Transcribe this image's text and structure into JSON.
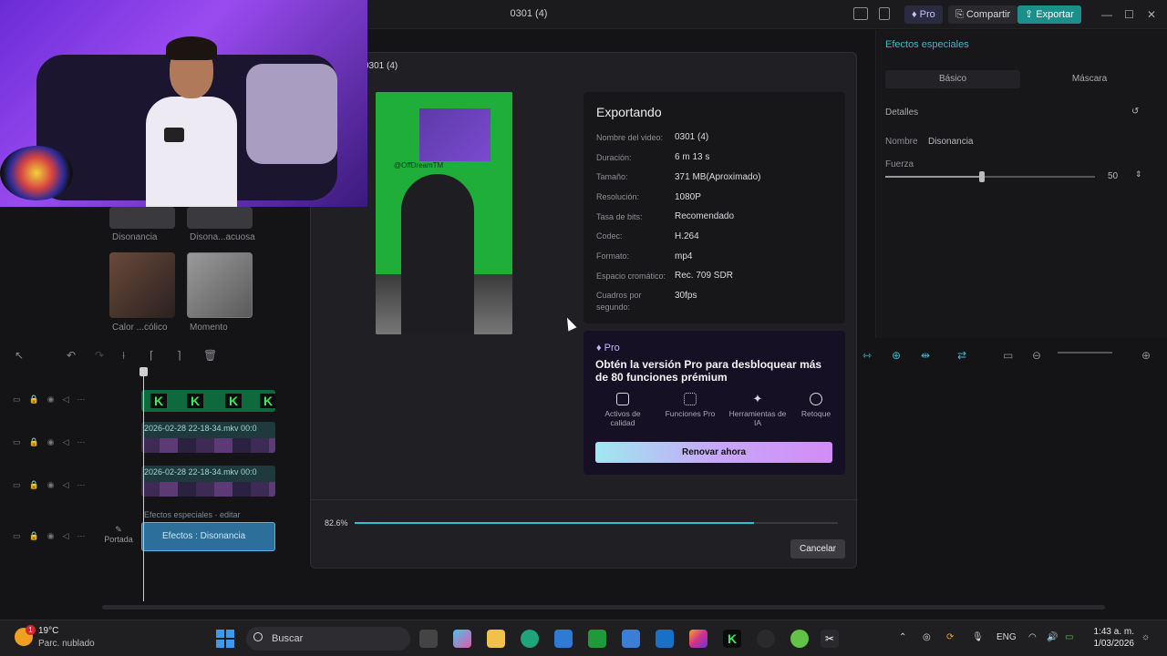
{
  "window": {
    "title": "0301 (4)",
    "pro_label": "Pro",
    "share_label": "Compartir",
    "export_label": "Exportar"
  },
  "media": {
    "items": [
      {
        "label": "Disonancia"
      },
      {
        "label": "Disona...acuosa"
      },
      {
        "label": "Calor ...cólico"
      },
      {
        "label": "Momento"
      }
    ]
  },
  "right_panel": {
    "title": "Efectos especiales",
    "tabs": [
      "Básico",
      "Máscara"
    ],
    "section": "Detalles",
    "name_label": "Nombre",
    "name_value": "Disonancia",
    "strength_label": "Fuerza",
    "strength_value": "50",
    "strength_fraction": 0.46
  },
  "timeline": {
    "clip_video_label": "2026-02-28 22-18-34.mkv  00:0",
    "clip_fx_header": "Efectos especiales · editar",
    "clip_fx_label": "Efectos : Disonancia",
    "portada_label": "Portada"
  },
  "export_dialog": {
    "title": "0301 (4)",
    "heading": "Exportando",
    "preview_tag": "@OffDreamTM",
    "details": [
      {
        "label": "Nombre del video:",
        "value": "0301 (4)"
      },
      {
        "label": "Duración:",
        "value": "6 m 13 s"
      },
      {
        "label": "Tamaño:",
        "value": "371 MB(Aproximado)"
      },
      {
        "label": "Resolución:",
        "value": "1080P"
      },
      {
        "label": "Tasa de bits:",
        "value": "Recomendado"
      },
      {
        "label": "Codec:",
        "value": "H.264"
      },
      {
        "label": "Formato:",
        "value": "mp4"
      },
      {
        "label": "Espacio cromático:",
        "value": "Rec. 709 SDR"
      },
      {
        "label": "Cuadros por segundo:",
        "value": "30fps"
      }
    ],
    "promo": {
      "badge": "Pro",
      "headline": "Obtén la versión Pro para desbloquear más de 80 funciones prémium",
      "features": [
        {
          "label": "Activos de calidad",
          "icon": "image-icon"
        },
        {
          "label": "Funciones Pro",
          "icon": "grid-icon"
        },
        {
          "label": "Herramientas de IA",
          "icon": "magic-wand-icon"
        },
        {
          "label": "Retoque",
          "icon": "camera-icon"
        }
      ],
      "cta": "Renovar ahora"
    },
    "progress_text": "82.6%",
    "progress_fraction": 0.826,
    "cancel_label": "Cancelar"
  },
  "taskbar": {
    "temperature": "19°C",
    "weather": "Parc. nublado",
    "notif_count": "1",
    "search_placeholder": "Buscar",
    "language": "ENG",
    "time": "1:43 a. m.",
    "date": "1/03/2026"
  },
  "colors": {
    "accent": "#29c4cf",
    "export_button": "#1d8f8a",
    "pro_purple": "#c3b6ff"
  }
}
